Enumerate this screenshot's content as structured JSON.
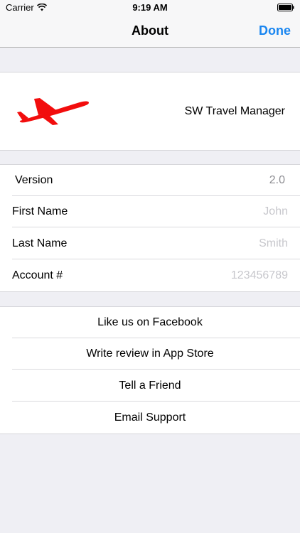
{
  "status_bar": {
    "carrier": "Carrier",
    "time": "9:19 AM",
    "wifi_icon": "wifi-icon",
    "battery_icon": "battery-icon"
  },
  "nav": {
    "title": "About",
    "done_label": "Done"
  },
  "app_header": {
    "logo_icon": "airplane-icon",
    "logo_color": "#f20d0d",
    "app_name": "SW Travel Manager"
  },
  "info": {
    "version_label": "Version",
    "version_value": "2.0",
    "first_name_label": "First Name",
    "first_name_placeholder": "John",
    "last_name_label": "Last Name",
    "last_name_placeholder": "Smith",
    "account_label": "Account #",
    "account_placeholder": "123456789"
  },
  "actions": {
    "facebook": "Like us on Facebook",
    "review": "Write review in App Store",
    "tell_friend": "Tell a Friend",
    "email_support": "Email Support"
  },
  "colors": {
    "accent": "#1a86f0",
    "background": "#efeff4",
    "placeholder": "#c7c7cc"
  }
}
